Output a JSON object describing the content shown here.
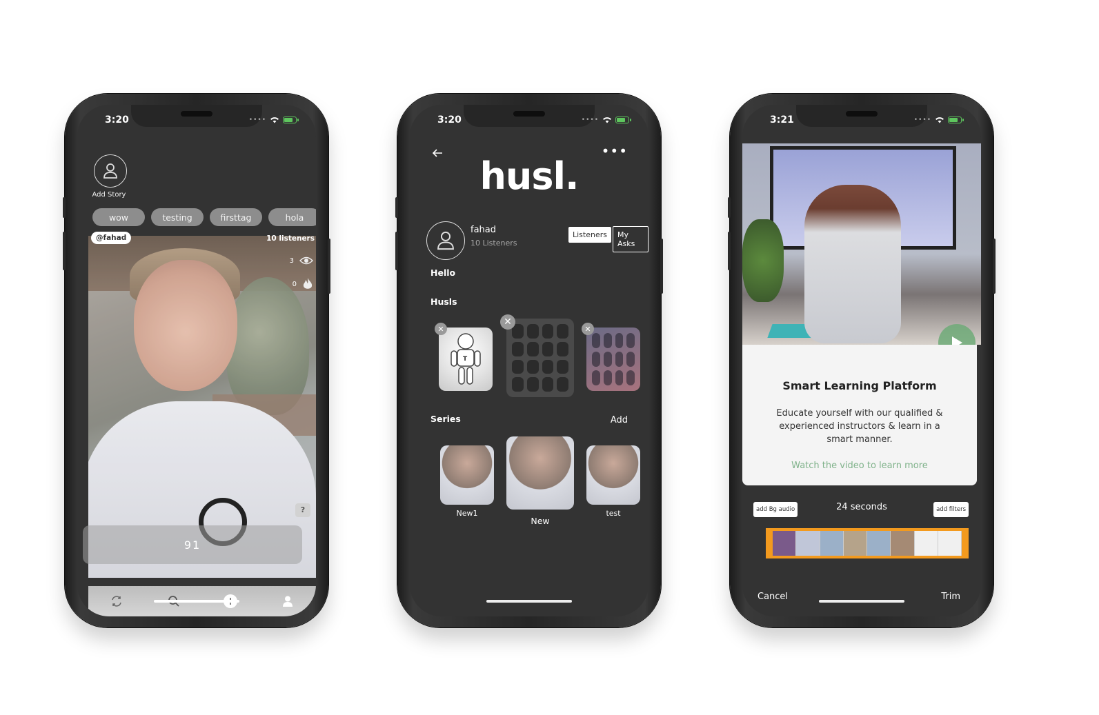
{
  "phone1": {
    "status_time": "3:20",
    "add_story_label": "Add Story",
    "tags": [
      "wow",
      "testing",
      "firsttag",
      "hola"
    ],
    "handle": "@fahad",
    "listeners": "10 listeners",
    "views": "3",
    "likes": "0",
    "help": "?",
    "counter": "91",
    "tabbar_icons": [
      "refresh-icon",
      "search-icon",
      "add-icon",
      "profile-icon"
    ]
  },
  "phone2": {
    "status_time": "3:20",
    "logo": "husl.",
    "profile_name": "fahad",
    "profile_sub": "10 Listeners",
    "btn_listeners": "Listeners",
    "btn_asks": "My Asks",
    "bio": "Hello",
    "husls_label": "Husls",
    "series_label": "Series",
    "add_label": "Add",
    "series_items": [
      "New1",
      "New",
      "test"
    ]
  },
  "phone3": {
    "status_time": "3:21",
    "card_title": "Smart Learning Platform",
    "card_text": "Educate yourself with our qualified & experienced instructors & learn in a smart manner.",
    "card_link": "Watch the video to learn more",
    "add_bg_audio": "add Bg audio",
    "seconds": "24 seconds",
    "add_filters": "add filters",
    "cancel": "Cancel",
    "trim": "Trim"
  },
  "colors": {
    "screen_bg": "#333333",
    "tag_bg": "#8d8d8d",
    "accent_green": "#7fb28a",
    "timeline_orange": "#f39a1e",
    "battery_green": "#5ec65e"
  }
}
